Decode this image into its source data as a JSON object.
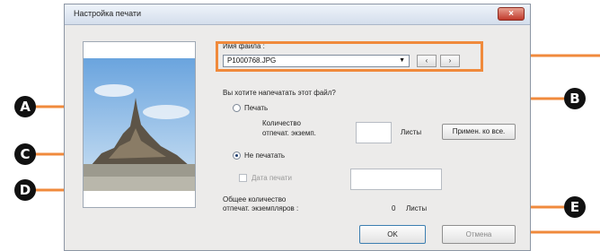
{
  "dialog": {
    "title": "Настройка печати",
    "close_label": "×",
    "filename_label": "Имя файла :",
    "filename_value": "P1000768.JPG",
    "prev_label": "‹",
    "next_label": "›",
    "question": "Вы хотите напечатать этот файл?",
    "print_option": "Печать",
    "copies_label_line1": "Количество",
    "copies_label_line2": "отпечат. экземп.",
    "copies_value": "",
    "sheets_unit": "Листы",
    "apply_all_label": "Примен. ко все.",
    "no_print_option": "Не печатать",
    "date_print_label": "Дата печати",
    "total_label_line1": "Общее количество",
    "total_label_line2": "отпечат. экземпляров :",
    "total_value": "0",
    "ok_label": "OK",
    "cancel_label": "Отмена"
  },
  "callouts": {
    "a": "A",
    "b": "B",
    "c": "C",
    "d": "D",
    "e": "E"
  },
  "accent_color": "#f08a3c"
}
